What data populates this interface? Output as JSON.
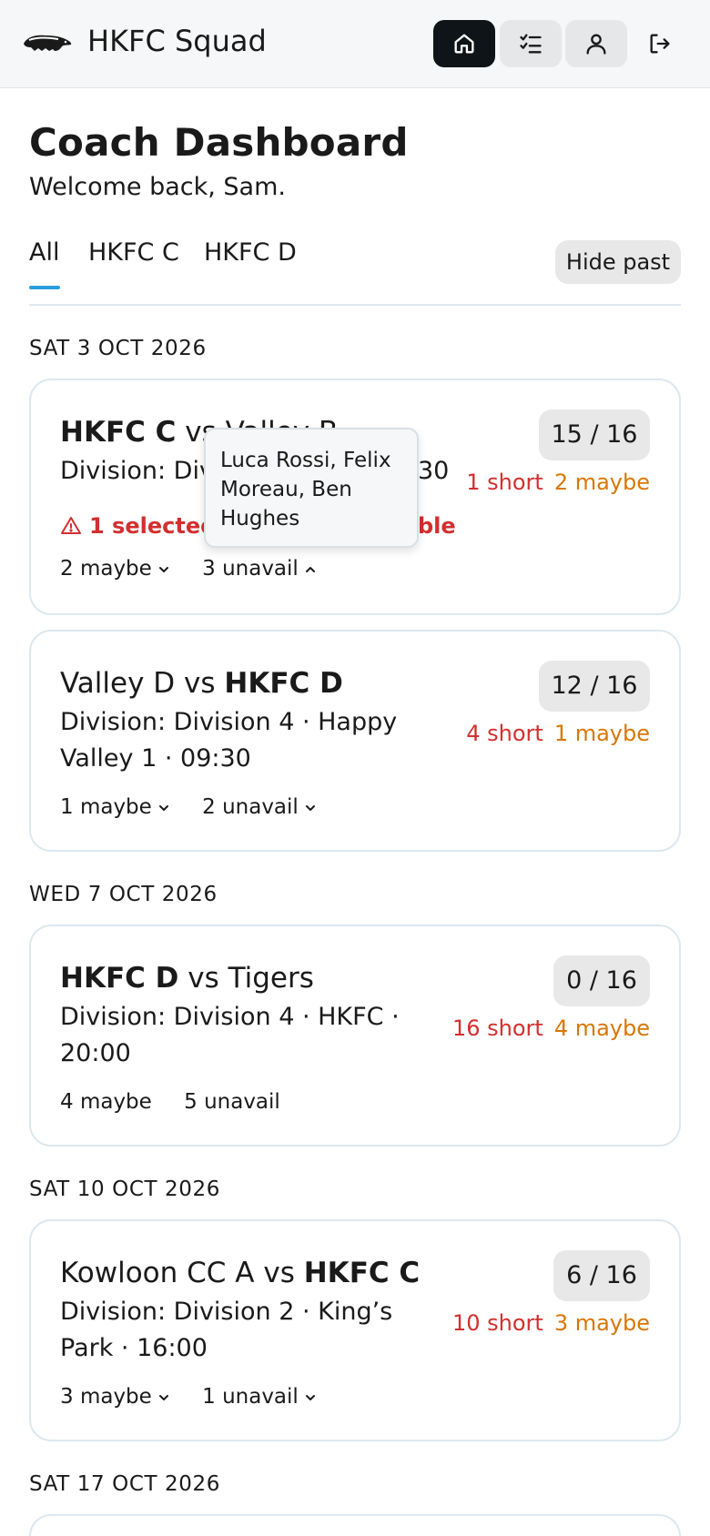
{
  "header": {
    "title": "HKFC Squad",
    "nav": [
      {
        "icon": "home-icon",
        "active": true
      },
      {
        "icon": "checklist-icon",
        "active": false
      },
      {
        "icon": "user-icon",
        "active": false
      },
      {
        "icon": "logout-icon",
        "active": false
      }
    ]
  },
  "page": {
    "title": "Coach Dashboard",
    "welcome": "Welcome back, Sam."
  },
  "tabs": {
    "items": [
      "All",
      "HKFC C",
      "HKFC D"
    ],
    "active": "All",
    "hide_past_label": "Hide past"
  },
  "colors": {
    "accent": "#2a9de0",
    "short": "#d32f2f",
    "maybe": "#d97706"
  },
  "groups": [
    {
      "date": "SAT 3 OCT 2026",
      "matches": [
        {
          "home": "HKFC C",
          "away": "Valley B",
          "home_is_club": true,
          "info_visible_left": "Division: Div",
          "info_visible_right": "30",
          "count": "15 / 16",
          "short": "1 short",
          "maybe": "2 maybe",
          "warning_left": "1 selected",
          "warning_right": "ble",
          "maybe_toggle": "2 maybe",
          "unavail_toggle": "3 unavail",
          "unavail_expanded": true,
          "tooltip": "Luca Rossi, Felix Moreau, Ben Hughes"
        },
        {
          "home": "Valley D",
          "away": "HKFC D",
          "home_is_club": false,
          "info": "Division: Division 4 · Happy Valley 1 · 09:30",
          "count": "12 / 16",
          "short": "4 short",
          "maybe": "1 maybe",
          "maybe_toggle": "1 maybe",
          "unavail_toggle": "2 unavail"
        }
      ]
    },
    {
      "date": "WED 7 OCT 2026",
      "matches": [
        {
          "home": "HKFC D",
          "away": "Tigers",
          "home_is_club": true,
          "info": "Division: Division 4 · HKFC · 20:00",
          "count": "0 / 16",
          "short": "16 short",
          "maybe": "4 maybe",
          "maybe_toggle": "4 maybe",
          "unavail_toggle": "5 unavail"
        }
      ]
    },
    {
      "date": "SAT 10 OCT 2026",
      "matches": [
        {
          "home": "Kowloon CC A",
          "away": "HKFC C",
          "home_is_club": false,
          "info": "Division: Division 2 · King’s Park · 16:00",
          "count": "6 / 16",
          "short": "10 short",
          "maybe": "3 maybe",
          "maybe_toggle": "3 maybe",
          "unavail_toggle": "1 unavail"
        }
      ]
    },
    {
      "date": "SAT 17 OCT 2026",
      "matches": []
    }
  ]
}
